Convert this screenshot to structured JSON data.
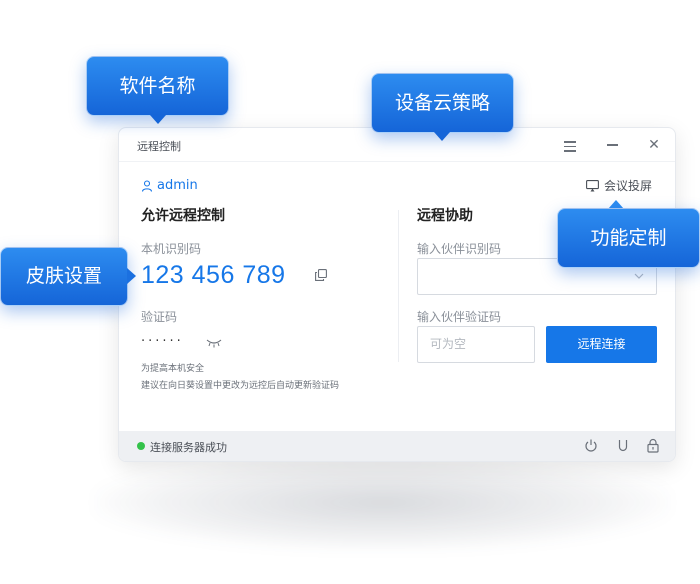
{
  "window": {
    "title": "远程控制"
  },
  "user": {
    "name": "admin"
  },
  "cast": {
    "label": "会议投屏"
  },
  "left_panel": {
    "heading": "允许远程控制",
    "id_label": "本机识别码",
    "id_value": "123 456 789",
    "code_label": "验证码",
    "code_mask": "······",
    "tip_line1": "为提高本机安全",
    "tip_line2": "建议在向日葵设置中更改为远控后自动更新验证码"
  },
  "right_panel": {
    "heading": "远程协助",
    "partner_id_label": "输入伙伴识别码",
    "partner_code_label": "输入伙伴验证码",
    "partner_code_placeholder": "可为空",
    "connect_label": "远程连接"
  },
  "status": {
    "text": "连接服务器成功",
    "color": "#33c24a"
  },
  "callouts": {
    "software_name": "软件名称",
    "cloud_policy": "设备云策略",
    "customization": "功能定制",
    "skin": "皮肤设置"
  },
  "colors": {
    "accent": "#1677e8",
    "callout": "#1e6fe0"
  }
}
